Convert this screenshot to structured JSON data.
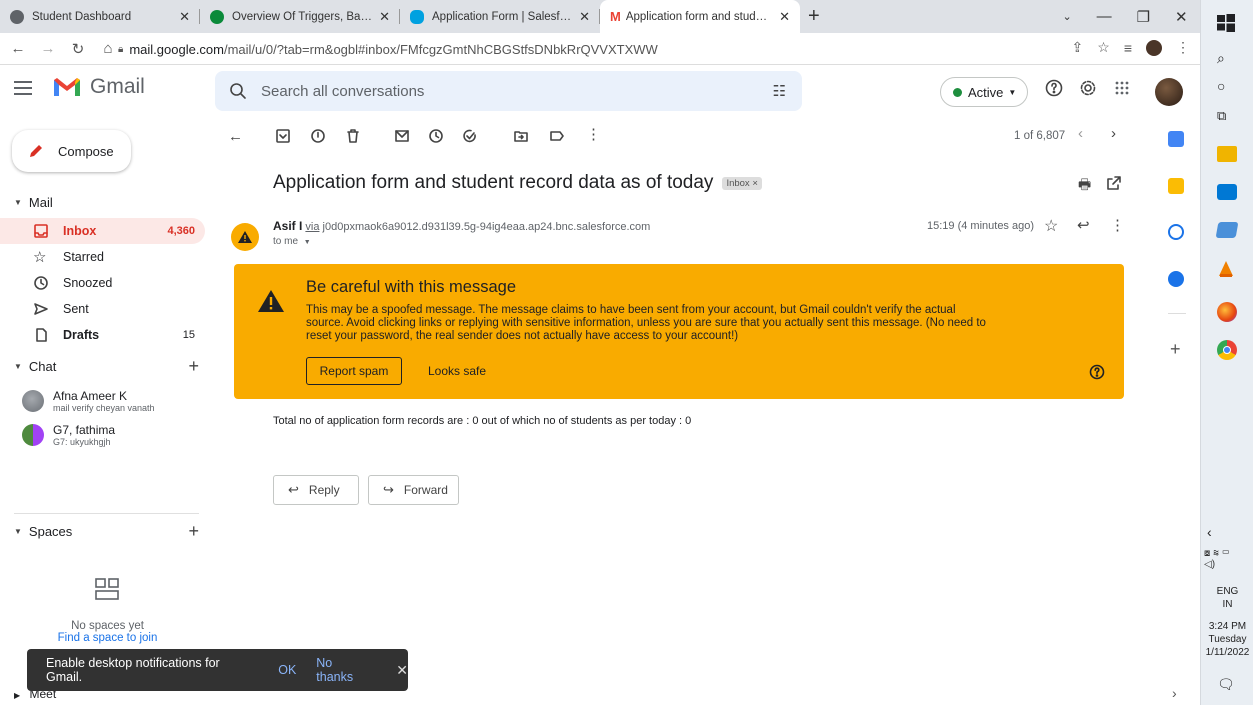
{
  "browser": {
    "tabs": [
      {
        "title": "Student Dashboard",
        "color": "#5f6368"
      },
      {
        "title": "Overview Of Triggers, Batch Apex",
        "color": "#0b8a3a"
      },
      {
        "title": "Application Form | Salesforce",
        "color": "#00a1e0"
      },
      {
        "title": "Application form and student rec",
        "color": "#ea4335"
      }
    ],
    "url_domain": "mail.google.com",
    "url_path": "/mail/u/0/?tab=rm&ogbl#inbox/FMfcgzGmtNhCBGStfsDNbkRrQVVXTXWW"
  },
  "header": {
    "app_name": "Gmail",
    "search_placeholder": "Search all conversations",
    "status": "Active"
  },
  "sidebar": {
    "compose_label": "Compose",
    "mail_heading": "Mail",
    "items": [
      {
        "label": "Inbox",
        "count": "4,360"
      },
      {
        "label": "Starred",
        "count": ""
      },
      {
        "label": "Snoozed",
        "count": ""
      },
      {
        "label": "Sent",
        "count": ""
      },
      {
        "label": "Drafts",
        "count": "15"
      }
    ],
    "chat_heading": "Chat",
    "chats": [
      {
        "name": "Afna Ameer K",
        "preview": "mail verify cheyan vanath"
      },
      {
        "name": "G7, fathima",
        "preview": "G7: ukyukhgjh"
      }
    ],
    "spaces_heading": "Spaces",
    "no_spaces": "No spaces yet",
    "find_space": "Find a space to join",
    "meet_heading": "Meet"
  },
  "toolbar": {
    "pager": "1 of 6,807"
  },
  "message": {
    "subject": "Application form and student record data as of today",
    "label_tag": "Inbox ×",
    "sender_name": "Asif I",
    "via_word": "via",
    "via_address": "j0d0pxmaok6a9012.d931l39.5g-94ig4eaa.ap24.bnc.salesforce.com",
    "to_me": "to me",
    "time": "15:19 (4 minutes ago)",
    "warning_title": "Be careful with this message",
    "warning_body": "This may be a spoofed message. The message claims to have been sent from your account, but Gmail couldn't verify the actual source. Avoid clicking links or replying with sensitive information, unless you are sure that you actually sent this message. (No need to reset your password, the real sender does not actually have access to your account!)",
    "report_spam": "Report spam",
    "looks_safe": "Looks safe",
    "body": "Total no of application form records are : 0 out of which no of students as per today : 0",
    "reply": "Reply",
    "forward": "Forward"
  },
  "snackbar": {
    "text": "Enable desktop notifications for Gmail.",
    "ok": "OK",
    "no_thanks": "No thanks"
  },
  "taskbar": {
    "lang1": "ENG",
    "lang2": "IN",
    "time": "3:24 PM",
    "day": "Tuesday",
    "date": "1/11/2022"
  },
  "colors": {
    "warning_bg": "#f9ab00",
    "inbox_selected_bg": "#fce8e6",
    "accent_red": "#d93025"
  }
}
